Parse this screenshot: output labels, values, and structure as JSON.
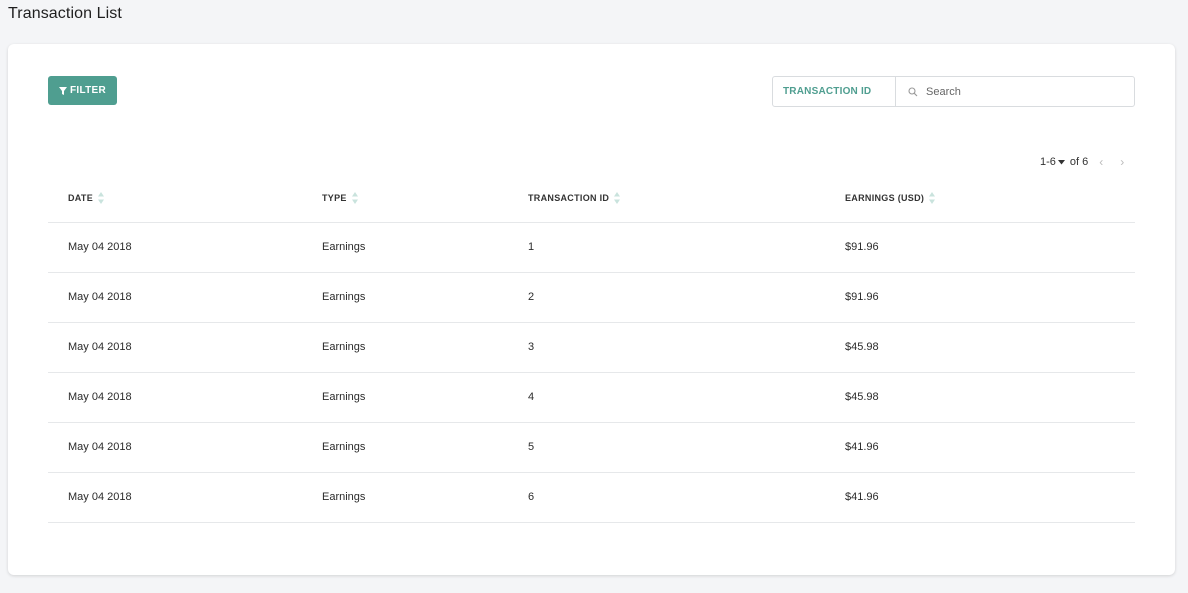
{
  "page": {
    "title": "Transaction List"
  },
  "toolbar": {
    "filter_label": "FILTER",
    "search_field": "TRANSACTION ID",
    "search_placeholder": "Search"
  },
  "pagination": {
    "range": "1-6",
    "total": "of 6"
  },
  "table": {
    "columns": [
      "DATE",
      "TYPE",
      "TRANSACTION ID",
      "EARNINGS (USD)"
    ],
    "rows": [
      [
        "May 04 2018",
        "Earnings",
        "1",
        "$91.96"
      ],
      [
        "May 04 2018",
        "Earnings",
        "2",
        "$91.96"
      ],
      [
        "May 04 2018",
        "Earnings",
        "3",
        "$45.98"
      ],
      [
        "May 04 2018",
        "Earnings",
        "4",
        "$45.98"
      ],
      [
        "May 04 2018",
        "Earnings",
        "5",
        "$41.96"
      ],
      [
        "May 04 2018",
        "Earnings",
        "6",
        "$41.96"
      ]
    ]
  },
  "colors": {
    "accent": "#4f9e90",
    "sort_arrow": "#c9e3dd"
  },
  "icons": {
    "filter": "filter-icon",
    "search": "search-icon",
    "sort": "sort-icon",
    "caret": "caret-down-icon"
  }
}
